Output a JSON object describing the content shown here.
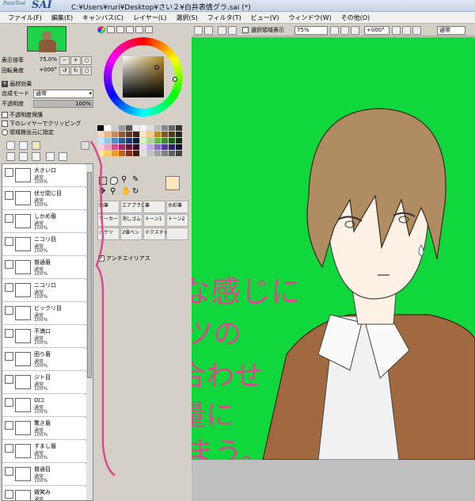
{
  "window": {
    "logo_small": "PaintTool",
    "logo_big": "SAI",
    "title": "C:¥Users¥ruri¥Desktop¥さい２¥白井表情グラ.sai (*)"
  },
  "menu": [
    "ファイル(F)",
    "編集(E)",
    "キャンバス(C)",
    "レイヤー(L)",
    "選択(S)",
    "フィルタ(T)",
    "ビュー(V)",
    "ウィンドウ(W)",
    "その他(O)"
  ],
  "navigator": {
    "zoom_label": "表示倍率",
    "zoom_value": "75.0%",
    "angle_label": "回転角度",
    "angle_value": "+000°"
  },
  "layer_props": {
    "section_title": "画材効果",
    "blend_label": "合成モード",
    "blend_value": "通常",
    "opacity_label": "不透明度",
    "opacity_value": "100%",
    "opacity_fraction": 1.0,
    "preserve_opacity": "不透明度保護",
    "clip_label": "下のレイヤーでクリッピング",
    "selection_source": "領域検出元に指定"
  },
  "layers": [
    {
      "name": "大きい口",
      "mode": "通常",
      "opacity": "100%"
    },
    {
      "name": "伏せ閉じ目",
      "mode": "通常",
      "opacity": "100%"
    },
    {
      "name": "しかめ眉",
      "mode": "通常",
      "opacity": "100%"
    },
    {
      "name": "ニコリ目",
      "mode": "通常",
      "opacity": "100%"
    },
    {
      "name": "普通眉",
      "mode": "通常",
      "opacity": "100%"
    },
    {
      "name": "ニコリ口",
      "mode": "通常",
      "opacity": "100%"
    },
    {
      "name": "ビックリ目",
      "mode": "通常",
      "opacity": "100%"
    },
    {
      "name": "不満口",
      "mode": "通常",
      "opacity": "100%"
    },
    {
      "name": "困り眉",
      "mode": "通常",
      "opacity": "100%"
    },
    {
      "name": "ジト目",
      "mode": "通常",
      "opacity": "100%"
    },
    {
      "name": "O口",
      "mode": "通常",
      "opacity": "100%"
    },
    {
      "name": "驚き眉",
      "mode": "通常",
      "opacity": "100%"
    },
    {
      "name": "すまし眉",
      "mode": "通常",
      "opacity": "100%"
    },
    {
      "name": "普通目",
      "mode": "通常",
      "opacity": "100%"
    },
    {
      "name": "微笑み",
      "mode": "通常",
      "opacity": "100%"
    }
  ],
  "tools": {
    "row1": [
      "鉛筆",
      "エアブラシ",
      "筆",
      "水彩筆"
    ],
    "row2": [
      "マーカー",
      "消しゴム",
      "トーン1",
      "トーン2"
    ],
    "row3": [
      "バケツ",
      "2値ペン",
      "テクスチャ1",
      ""
    ],
    "antialias": "アンチエイリアス"
  },
  "canvas_toolbar": {
    "show_selection": "選択領域表示",
    "zoom": "75%",
    "angle": "+000°",
    "mode": "通常"
  },
  "handwriting": [
    "こんな感じに",
    "パーツの",
    "組み合わせ",
    "で大量に",
    "作りまう。"
  ],
  "colors": {
    "canvas_bg": "#10d83c",
    "handwriting": "#d94a8c",
    "cardigan": "#a0693f",
    "hair": "#b08c62",
    "skin": "#fdf1e6"
  }
}
